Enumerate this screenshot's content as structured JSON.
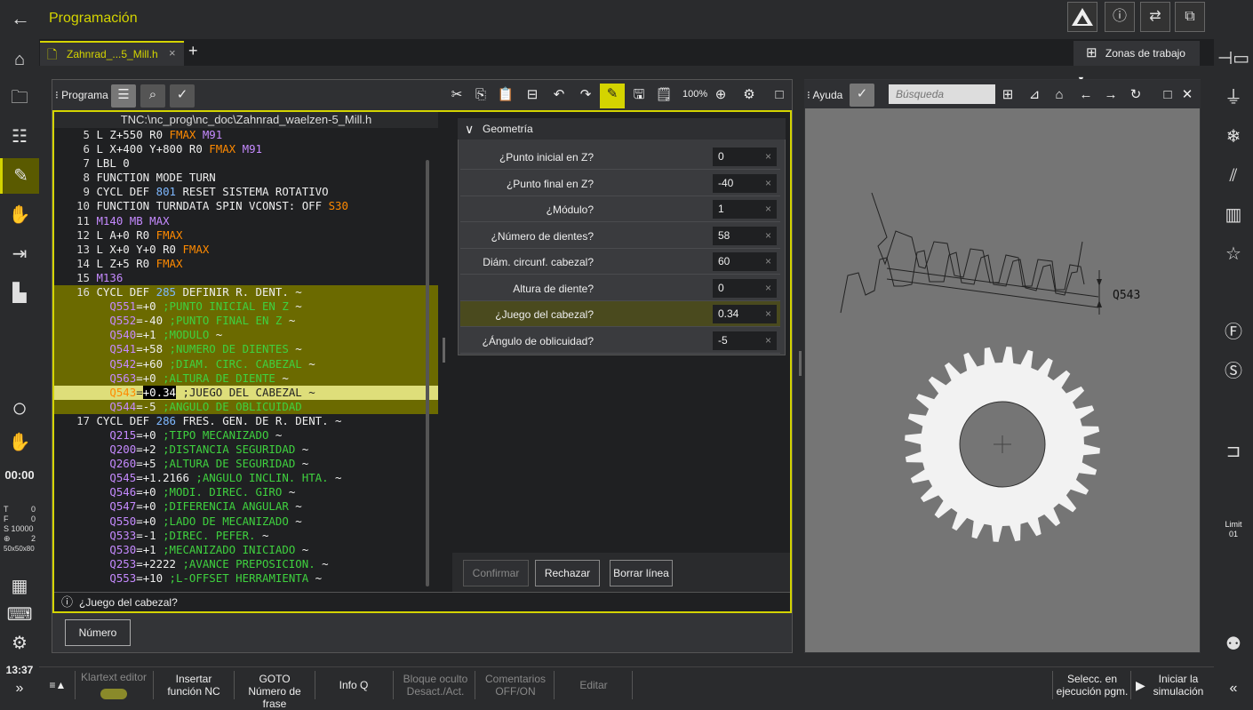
{
  "app": {
    "title": "Programación",
    "back_icon": "arrow-left-icon"
  },
  "top_buttons": [
    "warning-triangle-icon",
    "help-icon",
    "transfer-icon",
    "windows-icon"
  ],
  "tab": {
    "label": "Zahnrad_...5_Mill.h",
    "close": "×",
    "add": "+"
  },
  "workzones": {
    "label": "Zonas de trabajo"
  },
  "program_panel": {
    "title": "Programa",
    "path": "TNC:\\nc_prog\\nc_doc\\Zahnrad_waelzen-5_Mill.h",
    "zoom": "100%",
    "lines": [
      {
        "n": "5",
        "segs": [
          [
            "L Z+550 R0 ",
            ""
          ],
          [
            "FMAX",
            "or"
          ],
          [
            " ",
            ""
          ],
          [
            "M91",
            "pp"
          ]
        ]
      },
      {
        "n": "6",
        "segs": [
          [
            "L X+400 Y+800 R0 ",
            ""
          ],
          [
            "FMAX",
            "or"
          ],
          [
            " ",
            ""
          ],
          [
            "M91",
            "pp"
          ]
        ]
      },
      {
        "n": "7",
        "segs": [
          [
            "LBL 0",
            ""
          ]
        ]
      },
      {
        "n": "8",
        "segs": [
          [
            "FUNCTION MODE TURN",
            ""
          ]
        ]
      },
      {
        "n": "9",
        "segs": [
          [
            "CYCL DEF ",
            ""
          ],
          [
            "801",
            "bl"
          ],
          [
            " RESET SISTEMA ROTATIVO",
            ""
          ]
        ]
      },
      {
        "n": "10",
        "segs": [
          [
            "FUNCTION TURNDATA SPIN VCONST: OFF ",
            ""
          ],
          [
            "S30",
            "or"
          ]
        ]
      },
      {
        "n": "11",
        "segs": [
          [
            "M140 MB MAX",
            "pp"
          ]
        ]
      },
      {
        "n": "12",
        "segs": [
          [
            "L A+0 R0 ",
            ""
          ],
          [
            "FMAX",
            "or"
          ]
        ]
      },
      {
        "n": "13",
        "segs": [
          [
            "L X+0 Y+0 R0 ",
            ""
          ],
          [
            "FMAX",
            "or"
          ]
        ]
      },
      {
        "n": "14",
        "segs": [
          [
            "L Z+5 R0 ",
            ""
          ],
          [
            "FMAX",
            "or"
          ]
        ]
      },
      {
        "n": "15",
        "segs": [
          [
            "M136",
            "pp"
          ]
        ]
      },
      {
        "n": "16",
        "hl": "hl",
        "segs": [
          [
            "CYCL DEF ",
            ""
          ],
          [
            "285",
            "bl"
          ],
          [
            " DEFINIR R. DENT. ~",
            ""
          ]
        ]
      },
      {
        "n": "",
        "hl": "hl",
        "segs": [
          [
            "  Q551",
            "pp"
          ],
          [
            "=+0 ",
            ""
          ],
          [
            ";PUNTO INICIAL EN Z ",
            "gr"
          ],
          [
            "~",
            ""
          ]
        ]
      },
      {
        "n": "",
        "hl": "hl",
        "segs": [
          [
            "  Q552",
            "pp"
          ],
          [
            "=-40 ",
            ""
          ],
          [
            ";PUNTO FINAL EN Z ",
            "gr"
          ],
          [
            "~",
            ""
          ]
        ]
      },
      {
        "n": "",
        "hl": "hl",
        "segs": [
          [
            "  Q540",
            "pp"
          ],
          [
            "=+1 ",
            ""
          ],
          [
            ";MODULO ",
            "gr"
          ],
          [
            "~",
            ""
          ]
        ]
      },
      {
        "n": "",
        "hl": "hl",
        "segs": [
          [
            "  Q541",
            "pp"
          ],
          [
            "=+58 ",
            ""
          ],
          [
            ";NUMERO DE DIENTES ",
            "gr"
          ],
          [
            "~",
            ""
          ]
        ]
      },
      {
        "n": "",
        "hl": "hl",
        "segs": [
          [
            "  Q542",
            "pp"
          ],
          [
            "=+60 ",
            ""
          ],
          [
            ";DIAM. CIRC. CABEZAL ",
            "gr"
          ],
          [
            "~",
            ""
          ]
        ]
      },
      {
        "n": "",
        "hl": "hl",
        "segs": [
          [
            "  Q563",
            "pp"
          ],
          [
            "=+0 ",
            ""
          ],
          [
            ";ALTURA DE DIENTE ",
            "gr"
          ],
          [
            "~",
            ""
          ]
        ]
      },
      {
        "n": "",
        "hl": "hl2",
        "segs": [
          [
            "  Q543",
            "or"
          ],
          [
            "=",
            ""
          ],
          [
            "+0.34",
            "sel"
          ],
          [
            " ",
            ""
          ],
          [
            ";JUEGO DEL CABEZAL ",
            ""
          ],
          [
            "~",
            ""
          ]
        ]
      },
      {
        "n": "",
        "hl": "hl",
        "segs": [
          [
            "  Q544",
            "pp"
          ],
          [
            "=-5 ",
            ""
          ],
          [
            ";ANGULO DE OBLICUIDAD",
            "gr"
          ]
        ]
      },
      {
        "n": "17",
        "segs": [
          [
            "CYCL DEF ",
            ""
          ],
          [
            "286",
            "bl"
          ],
          [
            " FRES. GEN. DE R. DENT. ~",
            ""
          ]
        ]
      },
      {
        "n": "",
        "segs": [
          [
            "  Q215",
            "pp"
          ],
          [
            "=+0 ",
            ""
          ],
          [
            ";TIPO MECANIZADO ",
            "gr"
          ],
          [
            "~",
            ""
          ]
        ]
      },
      {
        "n": "",
        "segs": [
          [
            "  Q200",
            "pp"
          ],
          [
            "=+2 ",
            ""
          ],
          [
            ";DISTANCIA SEGURIDAD ",
            "gr"
          ],
          [
            "~",
            ""
          ]
        ]
      },
      {
        "n": "",
        "segs": [
          [
            "  Q260",
            "pp"
          ],
          [
            "=+5 ",
            ""
          ],
          [
            ";ALTURA DE SEGURIDAD ",
            "gr"
          ],
          [
            "~",
            ""
          ]
        ]
      },
      {
        "n": "",
        "segs": [
          [
            "  Q545",
            "pp"
          ],
          [
            "=+1.2166 ",
            ""
          ],
          [
            ";ANGULO INCLIN. HTA. ",
            "gr"
          ],
          [
            "~",
            ""
          ]
        ]
      },
      {
        "n": "",
        "segs": [
          [
            "  Q546",
            "pp"
          ],
          [
            "=+0 ",
            ""
          ],
          [
            ";MODI. DIREC. GIRO ",
            "gr"
          ],
          [
            "~",
            ""
          ]
        ]
      },
      {
        "n": "",
        "segs": [
          [
            "  Q547",
            "pp"
          ],
          [
            "=+0 ",
            ""
          ],
          [
            ";DIFERENCIA ANGULAR ",
            "gr"
          ],
          [
            "~",
            ""
          ]
        ]
      },
      {
        "n": "",
        "segs": [
          [
            "  Q550",
            "pp"
          ],
          [
            "=+0 ",
            ""
          ],
          [
            ";LADO DE MECANIZADO ",
            "gr"
          ],
          [
            "~",
            ""
          ]
        ]
      },
      {
        "n": "",
        "segs": [
          [
            "  Q533",
            "pp"
          ],
          [
            "=-1 ",
            ""
          ],
          [
            ";DIREC. PEFER. ",
            "gr"
          ],
          [
            "~",
            ""
          ]
        ]
      },
      {
        "n": "",
        "segs": [
          [
            "  Q530",
            "pp"
          ],
          [
            "=+1 ",
            ""
          ],
          [
            ";MECANIZADO INICIADO ",
            "gr"
          ],
          [
            "~",
            ""
          ]
        ]
      },
      {
        "n": "",
        "segs": [
          [
            "  Q253",
            "pp"
          ],
          [
            "=+2222 ",
            ""
          ],
          [
            ";AVANCE PREPOSICION. ",
            "gr"
          ],
          [
            "~",
            ""
          ]
        ]
      },
      {
        "n": "",
        "segs": [
          [
            "  Q553",
            "pp"
          ],
          [
            "=+10 ",
            ""
          ],
          [
            ";L-OFFSET HERRAMIENTA ",
            "gr"
          ],
          [
            "~",
            ""
          ]
        ]
      }
    ]
  },
  "geometry": {
    "title": "Geometría",
    "rows": [
      {
        "label": "¿Punto inicial en Z?",
        "value": "0"
      },
      {
        "label": "¿Punto final en Z?",
        "value": "-40"
      },
      {
        "label": "¿Módulo?",
        "value": "1"
      },
      {
        "label": "¿Número de dientes?",
        "value": "58"
      },
      {
        "label": "Diám. circunf. cabezal?",
        "value": "60"
      },
      {
        "label": "Altura de diente?",
        "value": "0"
      },
      {
        "label": "¿Juego del cabezal?",
        "value": "0.34",
        "active": true
      },
      {
        "label": "¿Ángulo de oblicuidad?",
        "value": "-5"
      }
    ],
    "clear": "×"
  },
  "buttons": {
    "confirm": "Confirmar",
    "reject": "Rechazar",
    "delete_line": "Borrar línea",
    "number": "Número"
  },
  "hint": "¿Juego del cabezal?",
  "help": {
    "title": "Ayuda",
    "search_placeholder": "Búsqueda",
    "label": "Q543"
  },
  "status": {
    "time_counter": "00:00",
    "t_label": "T",
    "t_val": "0",
    "f_label": "F",
    "f_val": "0",
    "s_label": "S",
    "s_val": "10000",
    "tool_val": "2",
    "tool_size": "50x50x80",
    "clock": "13:37",
    "limit": "Limit",
    "limit_val": "01"
  },
  "bottom": {
    "menu": "≡▲",
    "klartext": "Klartext editor",
    "insert": [
      "Insertar",
      "función NC"
    ],
    "goto": [
      "GOTO",
      "Número de frase"
    ],
    "infoq": "Info Q",
    "block": [
      "Bloque oculto",
      "Desact./Act."
    ],
    "comments": [
      "Comentarios",
      "OFF/ON"
    ],
    "edit": "Editar",
    "select": [
      "Selecc. en",
      "ejecución pgm."
    ],
    "sim": [
      "Iniciar la",
      "simulación"
    ],
    "expand": "»",
    "collapse": "«"
  }
}
